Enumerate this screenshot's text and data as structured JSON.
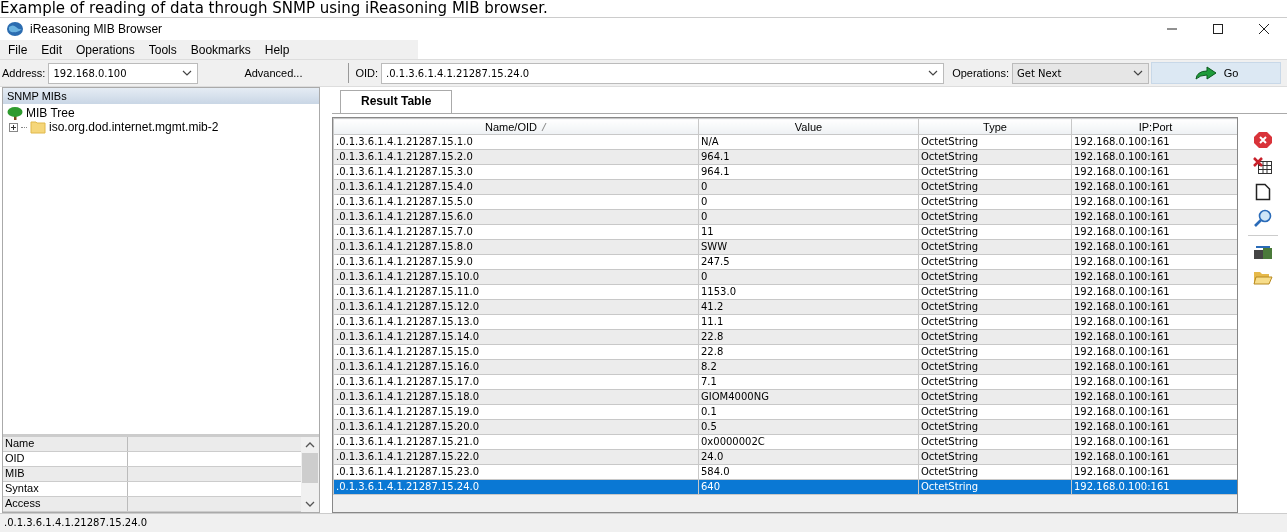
{
  "caption": "Example of reading of data through SNMP using  iReasoning MIB browser.",
  "window": {
    "title": "iReasoning MIB Browser"
  },
  "menu": [
    "File",
    "Edit",
    "Operations",
    "Tools",
    "Bookmarks",
    "Help"
  ],
  "toolbar": {
    "address_label": "Address:",
    "address": "192.168.0.100",
    "advanced_button": "Advanced...",
    "oid_label": "OID:",
    "oid": ".0.1.3.6.1.4.1.21287.15.24.0",
    "operations_label": "Operations:",
    "operation": "Get Next",
    "go_button": "Go"
  },
  "sidebar": {
    "title": "SNMP MIBs",
    "tree": {
      "label": "MIB Tree",
      "children": [
        {
          "label": "iso.org.dod.internet.mgmt.mib-2",
          "expanded": false
        }
      ]
    },
    "properties": [
      "Name",
      "OID",
      "MIB",
      "Syntax",
      "Access"
    ]
  },
  "tabs": [
    {
      "label": "Result Table",
      "selected": true
    }
  ],
  "table": {
    "columns": [
      "Name/OID",
      "Value",
      "Type",
      "IP:Port"
    ],
    "rows": [
      {
        "cells": [
          ".0.1.3.6.1.4.1.21287.15.1.0",
          "N/A",
          "OctetString",
          "192.168.0.100:161"
        ],
        "selected": false
      },
      {
        "cells": [
          ".0.1.3.6.1.4.1.21287.15.2.0",
          "964.1",
          "OctetString",
          "192.168.0.100:161"
        ],
        "selected": false
      },
      {
        "cells": [
          ".0.1.3.6.1.4.1.21287.15.3.0",
          "964.1",
          "OctetString",
          "192.168.0.100:161"
        ],
        "selected": false
      },
      {
        "cells": [
          ".0.1.3.6.1.4.1.21287.15.4.0",
          "0",
          "OctetString",
          "192.168.0.100:161"
        ],
        "selected": false
      },
      {
        "cells": [
          ".0.1.3.6.1.4.1.21287.15.5.0",
          "0",
          "OctetString",
          "192.168.0.100:161"
        ],
        "selected": false
      },
      {
        "cells": [
          ".0.1.3.6.1.4.1.21287.15.6.0",
          "0",
          "OctetString",
          "192.168.0.100:161"
        ],
        "selected": false
      },
      {
        "cells": [
          ".0.1.3.6.1.4.1.21287.15.7.0",
          "11",
          "OctetString",
          "192.168.0.100:161"
        ],
        "selected": false
      },
      {
        "cells": [
          ".0.1.3.6.1.4.1.21287.15.8.0",
          "SWW",
          "OctetString",
          "192.168.0.100:161"
        ],
        "selected": false
      },
      {
        "cells": [
          ".0.1.3.6.1.4.1.21287.15.9.0",
          "247.5",
          "OctetString",
          "192.168.0.100:161"
        ],
        "selected": false
      },
      {
        "cells": [
          ".0.1.3.6.1.4.1.21287.15.10.0",
          "0",
          "OctetString",
          "192.168.0.100:161"
        ],
        "selected": false
      },
      {
        "cells": [
          ".0.1.3.6.1.4.1.21287.15.11.0",
          "1153.0",
          "OctetString",
          "192.168.0.100:161"
        ],
        "selected": false
      },
      {
        "cells": [
          ".0.1.3.6.1.4.1.21287.15.12.0",
          "41.2",
          "OctetString",
          "192.168.0.100:161"
        ],
        "selected": false
      },
      {
        "cells": [
          ".0.1.3.6.1.4.1.21287.15.13.0",
          "11.1",
          "OctetString",
          "192.168.0.100:161"
        ],
        "selected": false
      },
      {
        "cells": [
          ".0.1.3.6.1.4.1.21287.15.14.0",
          "22.8",
          "OctetString",
          "192.168.0.100:161"
        ],
        "selected": false
      },
      {
        "cells": [
          ".0.1.3.6.1.4.1.21287.15.15.0",
          "22.8",
          "OctetString",
          "192.168.0.100:161"
        ],
        "selected": false
      },
      {
        "cells": [
          ".0.1.3.6.1.4.1.21287.15.16.0",
          "8.2",
          "OctetString",
          "192.168.0.100:161"
        ],
        "selected": false
      },
      {
        "cells": [
          ".0.1.3.6.1.4.1.21287.15.17.0",
          "7.1",
          "OctetString",
          "192.168.0.100:161"
        ],
        "selected": false
      },
      {
        "cells": [
          ".0.1.3.6.1.4.1.21287.15.18.0",
          "GIOM4000NG",
          "OctetString",
          "192.168.0.100:161"
        ],
        "selected": false
      },
      {
        "cells": [
          ".0.1.3.6.1.4.1.21287.15.19.0",
          "0.1",
          "OctetString",
          "192.168.0.100:161"
        ],
        "selected": false
      },
      {
        "cells": [
          ".0.1.3.6.1.4.1.21287.15.20.0",
          "0.5",
          "OctetString",
          "192.168.0.100:161"
        ],
        "selected": false
      },
      {
        "cells": [
          ".0.1.3.6.1.4.1.21287.15.21.0",
          "0x0000002C",
          "OctetString",
          "192.168.0.100:161"
        ],
        "selected": false
      },
      {
        "cells": [
          ".0.1.3.6.1.4.1.21287.15.22.0",
          "24.0",
          "OctetString",
          "192.168.0.100:161"
        ],
        "selected": false
      },
      {
        "cells": [
          ".0.1.3.6.1.4.1.21287.15.23.0",
          "584.0",
          "OctetString",
          "192.168.0.100:161"
        ],
        "selected": false
      },
      {
        "cells": [
          ".0.1.3.6.1.4.1.21287.15.24.0",
          "640",
          "OctetString",
          "192.168.0.100:161"
        ],
        "selected": true
      }
    ]
  },
  "status_bar": ".0.1.3.6.1.4.1.21287.15.24.0"
}
